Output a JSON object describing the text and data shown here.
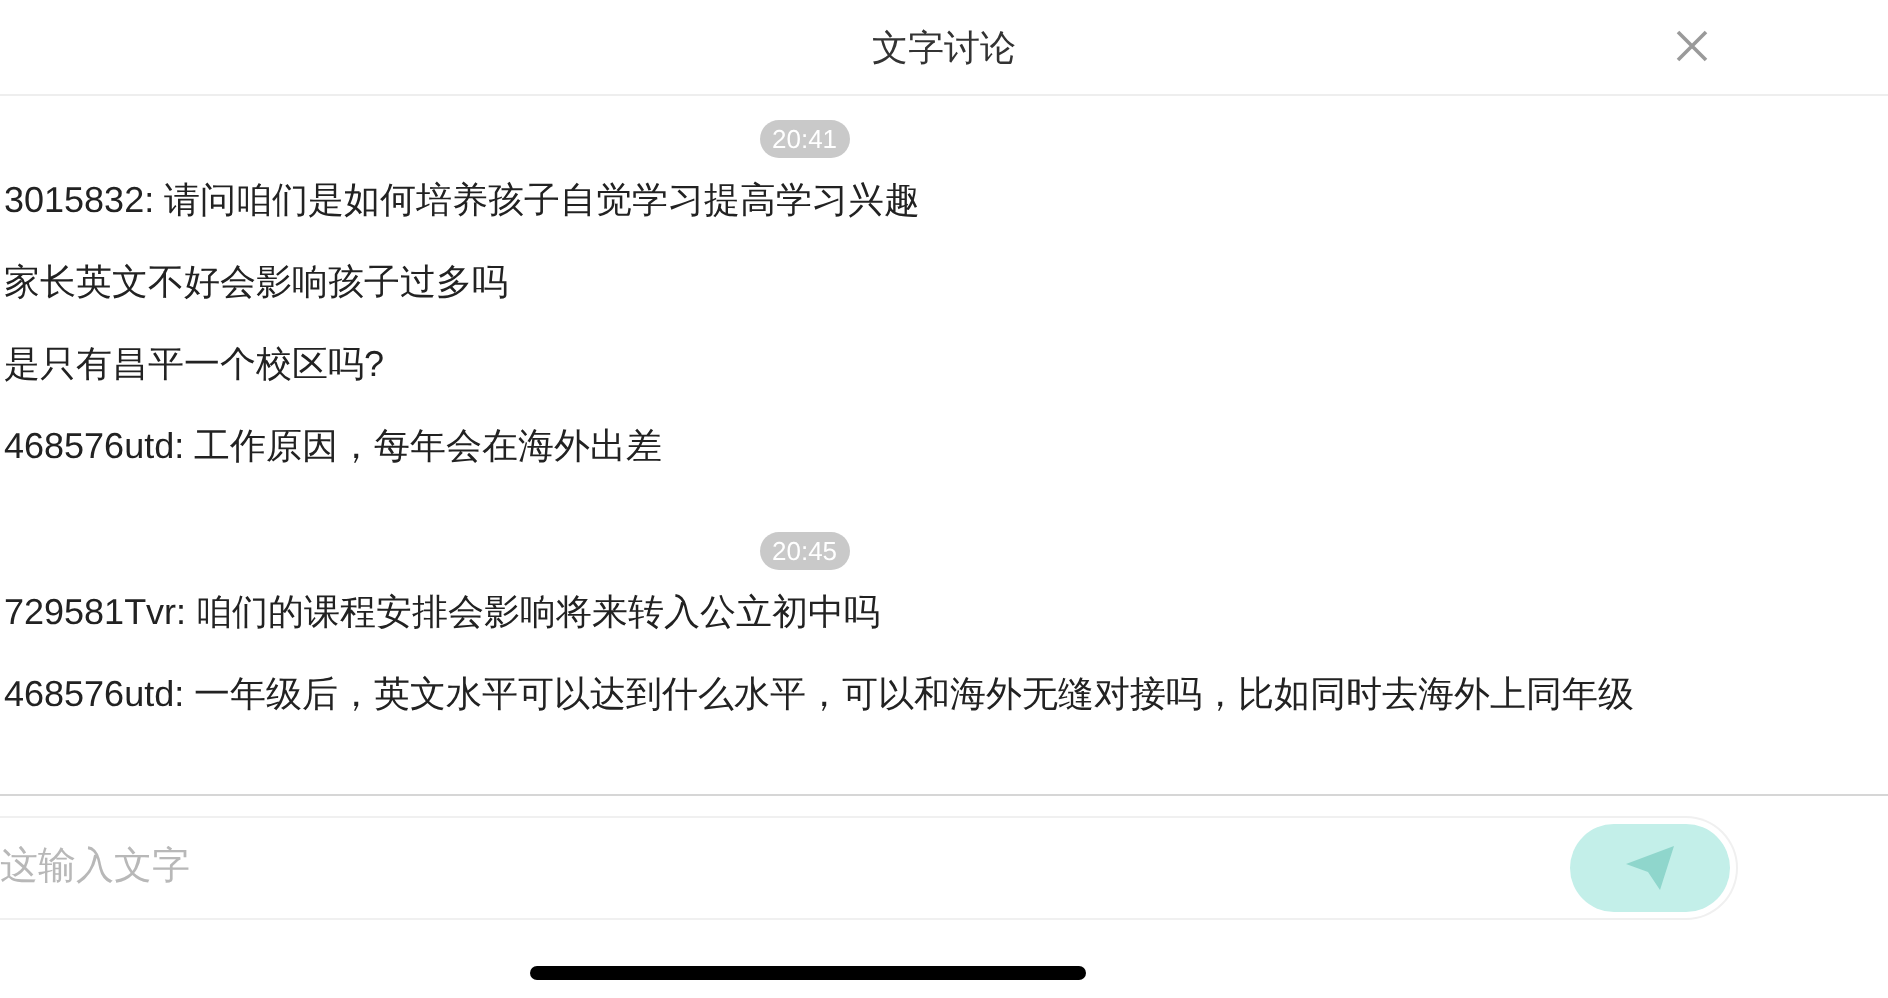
{
  "header": {
    "title": "文字讨论"
  },
  "groups": [
    {
      "time": "20:41",
      "messages": [
        "3015832: 请问咱们是如何培养孩子自觉学习提高学习兴趣",
        "家长英文不好会影响孩子过多吗",
        "是只有昌平一个校区吗?",
        "468576utd: 工作原因，每年会在海外出差"
      ]
    },
    {
      "time": "20:45",
      "messages": [
        "729581Tvr: 咱们的课程安排会影响将来转入公立初中吗",
        "468576utd: 一年级后，英文水平可以达到什么水平，可以和海外无缝对接吗，比如同时去海外上同年级"
      ]
    }
  ],
  "input": {
    "placeholder": "这输入文字"
  },
  "send_button": {
    "disabled": true
  }
}
